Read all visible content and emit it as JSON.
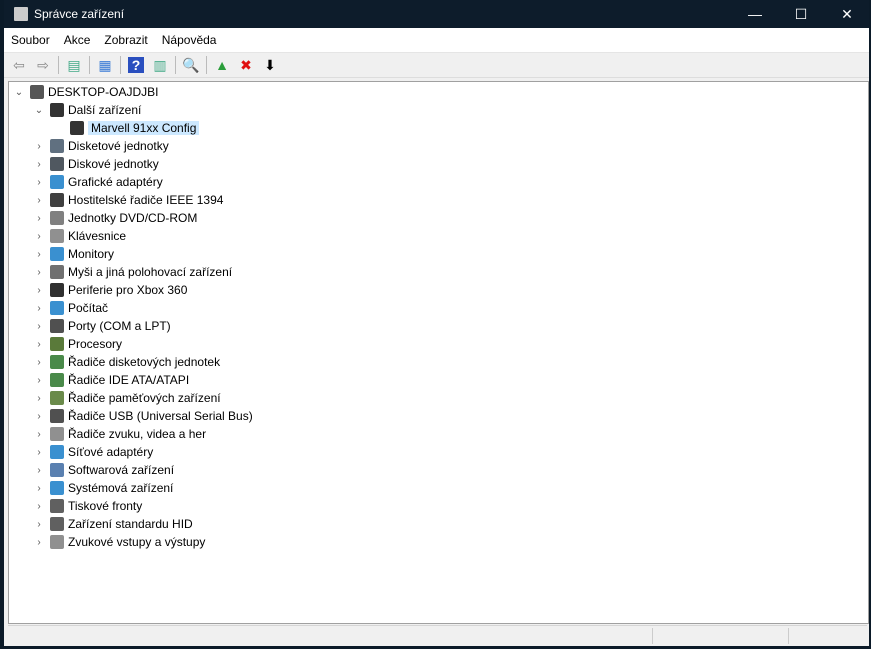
{
  "window": {
    "title": "Správce zařízení",
    "minimize": "—",
    "maximize": "☐",
    "close": "✕"
  },
  "menu": [
    "Soubor",
    "Akce",
    "Zobrazit",
    "Nápověda"
  ],
  "toolbar": [
    {
      "name": "back-icon",
      "glyph": "⇦",
      "color": "#888"
    },
    {
      "name": "forward-icon",
      "glyph": "⇨",
      "color": "#888"
    },
    {
      "sep": true
    },
    {
      "name": "show-hide-console-tree-icon",
      "glyph": "▤",
      "color": "#4a8"
    },
    {
      "sep": true
    },
    {
      "name": "properties-icon",
      "glyph": "▦",
      "color": "#3a7bd5"
    },
    {
      "sep": true
    },
    {
      "name": "help-icon",
      "glyph": "?",
      "color": "#fff",
      "bg": "#2a4fbf"
    },
    {
      "name": "action-pane-icon",
      "glyph": "▥",
      "color": "#4a8"
    },
    {
      "sep": true
    },
    {
      "name": "scan-hardware-icon",
      "glyph": "🔍",
      "color": "#3a7bd5"
    },
    {
      "sep": true
    },
    {
      "name": "update-driver-icon",
      "glyph": "▲",
      "color": "#2a9d3a"
    },
    {
      "name": "uninstall-icon",
      "glyph": "✖",
      "color": "#e01010"
    },
    {
      "name": "disable-icon",
      "glyph": "⬇",
      "color": "#000"
    }
  ],
  "tree": {
    "root": "DESKTOP-OAJDJBI",
    "expanded": {
      "label": "Další zařízení",
      "child": "Marvell 91xx Config"
    },
    "categories": [
      "Disketové jednotky",
      "Diskové jednotky",
      "Grafické adaptéry",
      "Hostitelské řadiče IEEE 1394",
      "Jednotky DVD/CD-ROM",
      "Klávesnice",
      "Monitory",
      "Myši a jiná polohovací zařízení",
      "Periferie pro Xbox 360",
      "Počítač",
      "Porty (COM a LPT)",
      "Procesory",
      "Řadiče disketových jednotek",
      "Řadiče IDE ATA/ATAPI",
      "Řadiče paměťových zařízení",
      "Řadiče USB (Universal Serial Bus)",
      "Řadiče zvuku, videa a her",
      "Síťové adaptéry",
      "Softwarová zařízení",
      "Systémová zařízení",
      "Tiskové fronty",
      "Zařízení standardu HID",
      "Zvukové vstupy a výstupy"
    ],
    "icon_colors": [
      "#607080",
      "#505860",
      "#3a90d0",
      "#404040",
      "#808080",
      "#909090",
      "#3a90d0",
      "#707070",
      "#303030",
      "#3a90d0",
      "#505050",
      "#5a7a3a",
      "#4a8a4a",
      "#4a8a4a",
      "#6a8a4a",
      "#505050",
      "#909090",
      "#3a90d0",
      "#5a80b0",
      "#3a90d0",
      "#606060",
      "#606060",
      "#909090"
    ]
  }
}
